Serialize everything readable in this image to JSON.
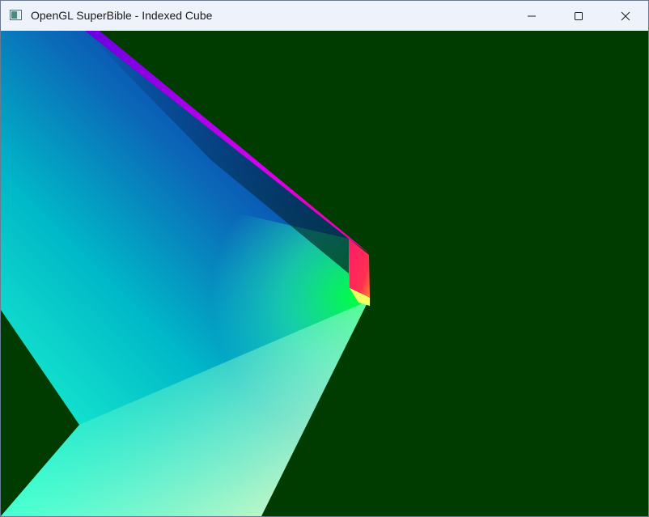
{
  "window": {
    "title": "OpenGL SuperBible - Indexed Cube",
    "icon": "app-window-icon",
    "controls": {
      "minimize_icon": "minimize-icon",
      "maximize_icon": "maximize-icon",
      "close_icon": "close-icon"
    }
  },
  "canvas": {
    "background_color": "#003c00",
    "scene": "indexed-cube-render",
    "face_colors": [
      "#0a1fb4",
      "#e000f0",
      "#ff2a5a",
      "#00ff66",
      "#00e8c0",
      "#ffffb0"
    ]
  }
}
